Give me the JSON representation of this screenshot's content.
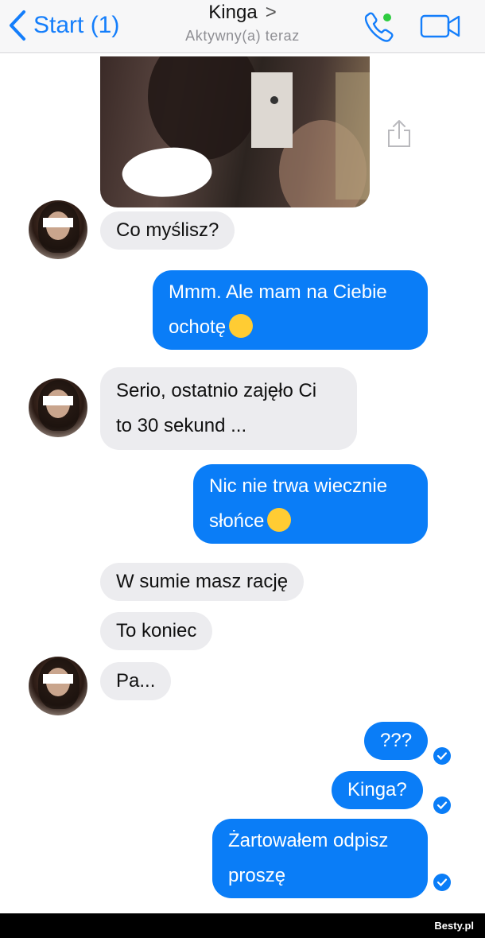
{
  "header": {
    "back_label": "Start (1)",
    "contact_name": "Kinga",
    "name_chevron": ">",
    "status": "Aktywny(a) teraz",
    "call_online_color": "#2ecc40"
  },
  "messages": [
    {
      "id": "m1",
      "dir": "in",
      "text": "Co myślisz?"
    },
    {
      "id": "m2",
      "dir": "out",
      "lines": [
        "Mmm. Ale mam na Ciebie",
        "ochotę"
      ],
      "emoji": "slight-smile"
    },
    {
      "id": "m3",
      "dir": "in",
      "lines": [
        "Serio, ostatnio zajęło Ci",
        "to 30 sekund ..."
      ]
    },
    {
      "id": "m4",
      "dir": "out",
      "lines": [
        "Nic nie trwa wiecznie",
        "słońce"
      ],
      "emoji": "kissing-face"
    },
    {
      "id": "m5",
      "dir": "in",
      "text": "W sumie masz rację"
    },
    {
      "id": "m6",
      "dir": "in",
      "text": "To koniec"
    },
    {
      "id": "m7",
      "dir": "in",
      "text": "Pa..."
    },
    {
      "id": "m8",
      "dir": "out",
      "text": "???",
      "read": true
    },
    {
      "id": "m9",
      "dir": "out",
      "text": "Kinga?",
      "read": true
    },
    {
      "id": "m10",
      "dir": "out",
      "lines": [
        "Żartowałem odpisz",
        "proszę"
      ],
      "read": true
    }
  ],
  "footer": {
    "watermark": "Besty.pl"
  },
  "colors": {
    "accent": "#147efb",
    "outgoing": "#0a7df7",
    "incoming": "#ececef"
  }
}
